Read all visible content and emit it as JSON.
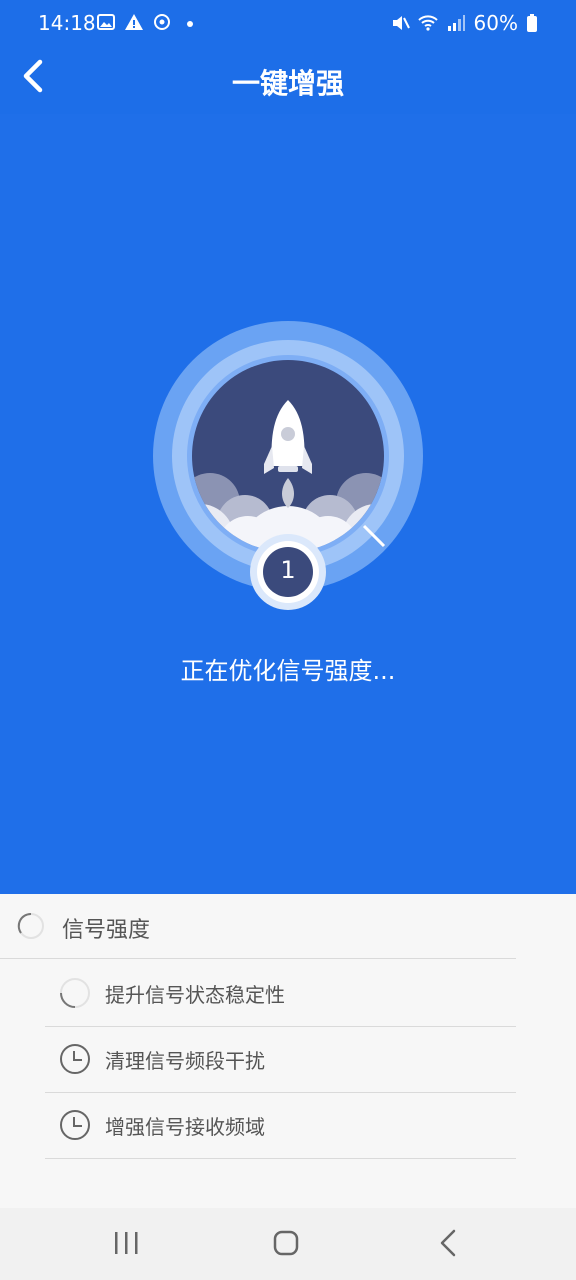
{
  "statusbar": {
    "time": "14:18",
    "battery": "60%",
    "icons_left": [
      "image-icon",
      "warning-icon",
      "sync-icon",
      "dot-icon"
    ],
    "icons_right": [
      "mute-icon",
      "wifi-icon",
      "signal-icon",
      "battery-icon"
    ]
  },
  "header": {
    "title": "一键增强"
  },
  "hero": {
    "step_number": "1",
    "status_text": "正在优化信号强度...",
    "colors": {
      "background": "#1f6fe9",
      "inner_circle": "#3a4a7e",
      "ring": "#7fb0f5"
    }
  },
  "panel": {
    "group_label": "信号强度",
    "tasks": [
      {
        "label": "提升信号状态稳定性",
        "state": "running"
      },
      {
        "label": "清理信号频段干扰",
        "state": "pending"
      },
      {
        "label": "增强信号接收频域",
        "state": "pending"
      }
    ]
  },
  "navbar": {
    "buttons": [
      "recent-apps-icon",
      "home-icon",
      "back-icon"
    ]
  }
}
